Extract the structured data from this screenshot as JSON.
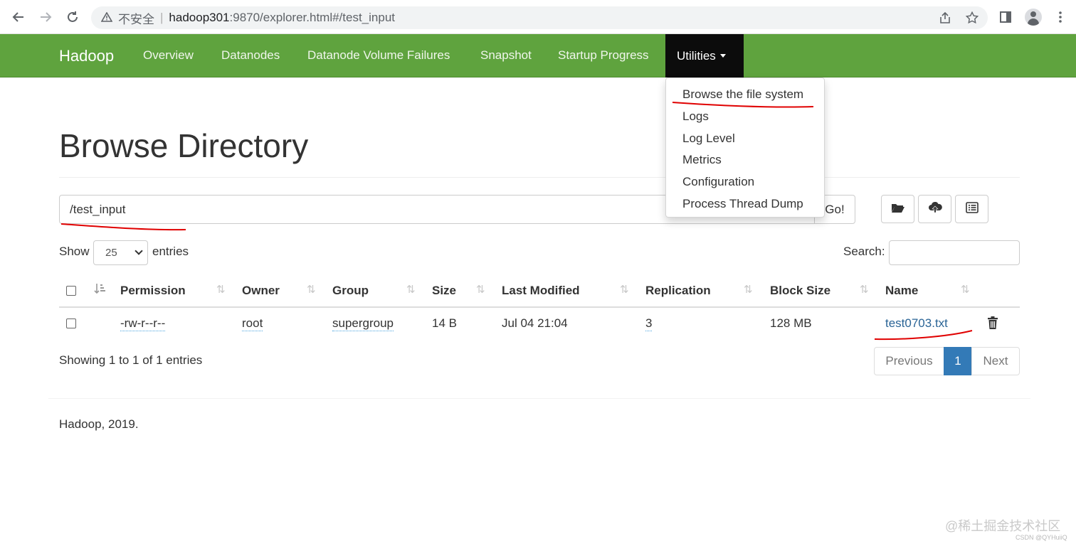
{
  "browser": {
    "insecure_label": "不安全",
    "separator": "|",
    "url_host": "hadoop301",
    "url_path": ":9870/explorer.html#/test_input"
  },
  "navbar": {
    "brand": "Hadoop",
    "items": [
      {
        "label": "Overview"
      },
      {
        "label": "Datanodes"
      },
      {
        "label": "Datanode Volume Failures"
      },
      {
        "label": "Snapshot"
      },
      {
        "label": "Startup Progress"
      }
    ],
    "active": {
      "label": "Utilities"
    },
    "bg_color": "#5fa33e",
    "active_bg_color": "#0c0c0c"
  },
  "dropdown": {
    "items": [
      {
        "label": "Browse the file system"
      },
      {
        "label": "Logs"
      },
      {
        "label": "Log Level"
      },
      {
        "label": "Metrics"
      },
      {
        "label": "Configuration"
      },
      {
        "label": "Process Thread Dump"
      }
    ]
  },
  "page": {
    "title": "Browse Directory",
    "path_value": "/test_input",
    "go_label": "Go!"
  },
  "toolbar": {
    "icons": [
      "folder-open-icon",
      "cloud-upload-icon",
      "list-alt-icon"
    ]
  },
  "table_controls": {
    "show_label": "Show",
    "entries_value": "25",
    "entries_label": "entries",
    "search_label": "Search:",
    "search_value": ""
  },
  "table": {
    "columns": [
      "Permission",
      "Owner",
      "Group",
      "Size",
      "Last Modified",
      "Replication",
      "Block Size",
      "Name"
    ],
    "rows": [
      {
        "permission": "-rw-r--r--",
        "owner": "root",
        "group": "supergroup",
        "size": "14 B",
        "last_modified": "Jul 04 21:04",
        "replication": "3",
        "block_size": "128 MB",
        "name": "test0703.txt"
      }
    ]
  },
  "pagination": {
    "summary": "Showing 1 to 1 of 1 entries",
    "previous": "Previous",
    "current": "1",
    "next": "Next"
  },
  "footer": {
    "text": "Hadoop, 2019."
  },
  "watermark": {
    "line1": "@稀土掘金技术社区",
    "line2": "CSDN @QYHuiiQ"
  },
  "colors": {
    "link": "#2a6496",
    "active_page": "#337ab7",
    "annotation": "#e00000"
  }
}
